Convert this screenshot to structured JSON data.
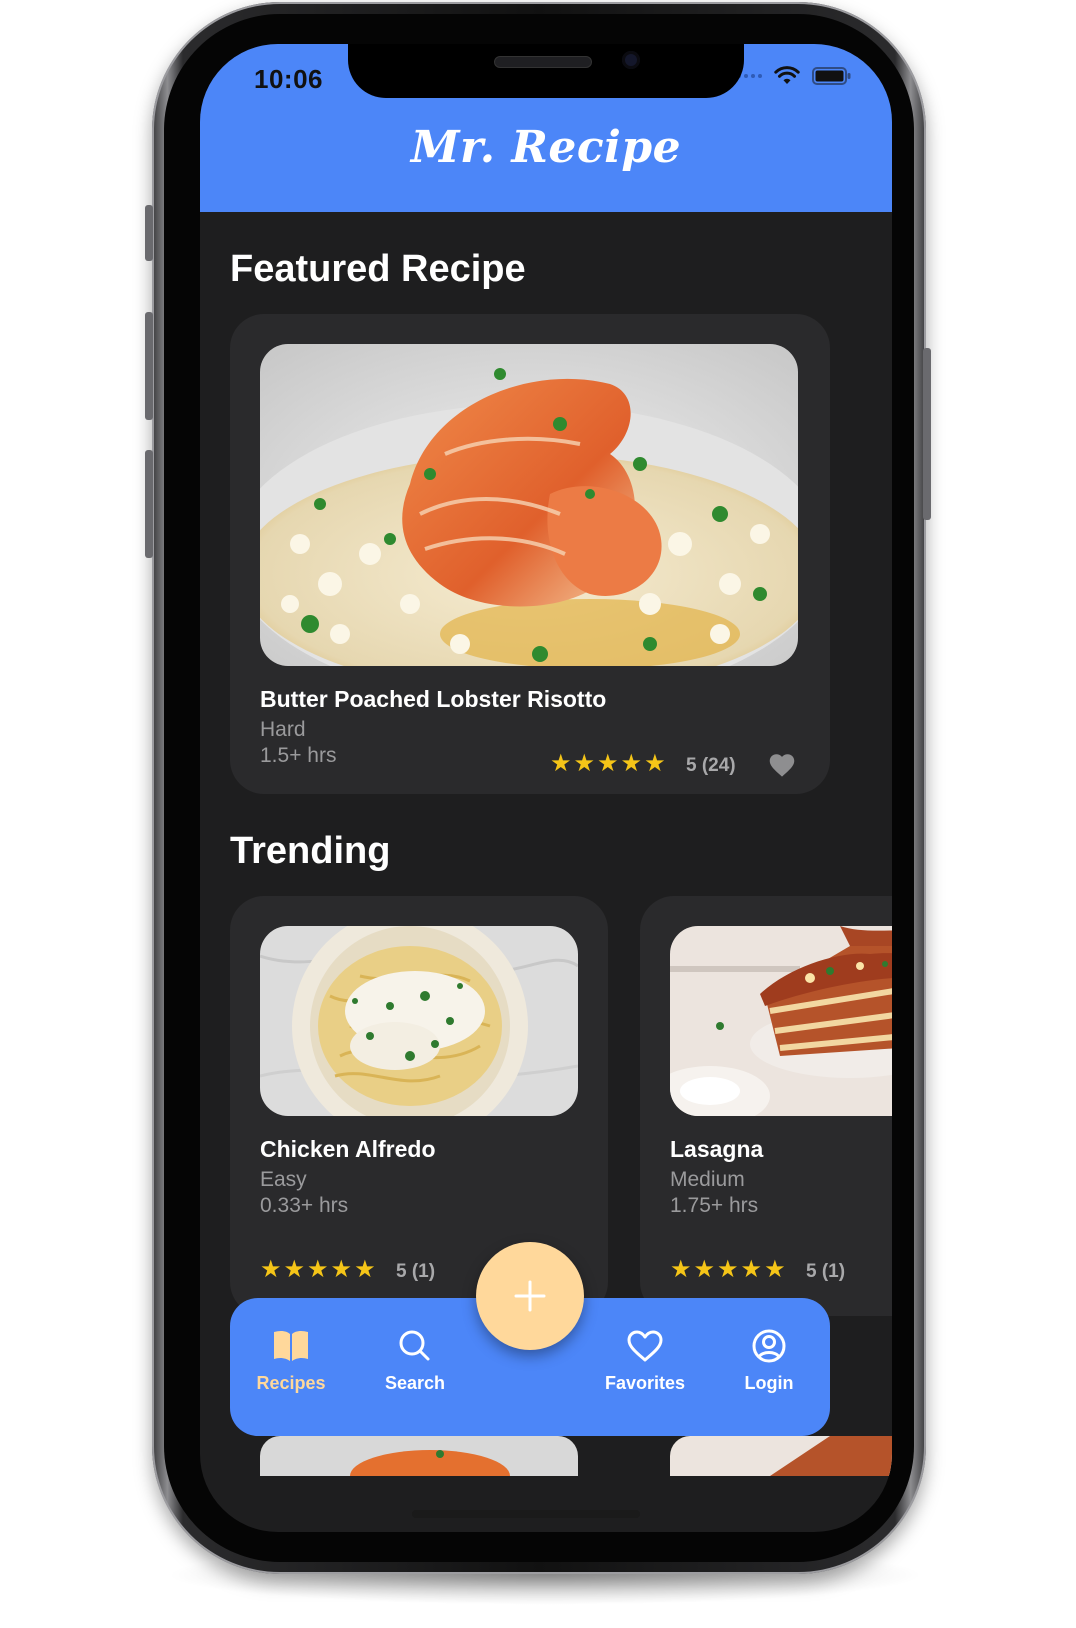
{
  "status_bar": {
    "time": "10:06"
  },
  "header": {
    "title": "Mr. Recipe"
  },
  "featured": {
    "section_title": "Featured Recipe",
    "recipe": {
      "name": "Butter Poached Lobster Risotto",
      "difficulty": "Hard",
      "time": "1.5+ hrs",
      "rating_text": "5 (24)",
      "stars": 5
    }
  },
  "trending": {
    "section_title": "Trending",
    "recipes": [
      {
        "name": "Chicken Alfredo",
        "difficulty": "Easy",
        "time": "0.33+ hrs",
        "rating_text": "5 (1)",
        "stars": 5
      },
      {
        "name": "Lasagna",
        "difficulty": "Medium",
        "time": "1.75+ hrs",
        "rating_text": "5 (1)",
        "stars": 5
      }
    ]
  },
  "bottom_nav": {
    "items": [
      {
        "label": "Recipes",
        "icon": "book-icon",
        "active": true
      },
      {
        "label": "Search",
        "icon": "search-icon",
        "active": false
      },
      {
        "label": "Favorites",
        "icon": "heart-outline-icon",
        "active": false
      },
      {
        "label": "Login",
        "icon": "user-circle-icon",
        "active": false
      }
    ],
    "fab_icon": "plus-icon"
  },
  "colors": {
    "header_blue": "#4c86f8",
    "background": "#1e1e1f",
    "card": "#2a2a2c",
    "star_gold": "#f5c518",
    "accent_peach": "#ffd89b"
  }
}
